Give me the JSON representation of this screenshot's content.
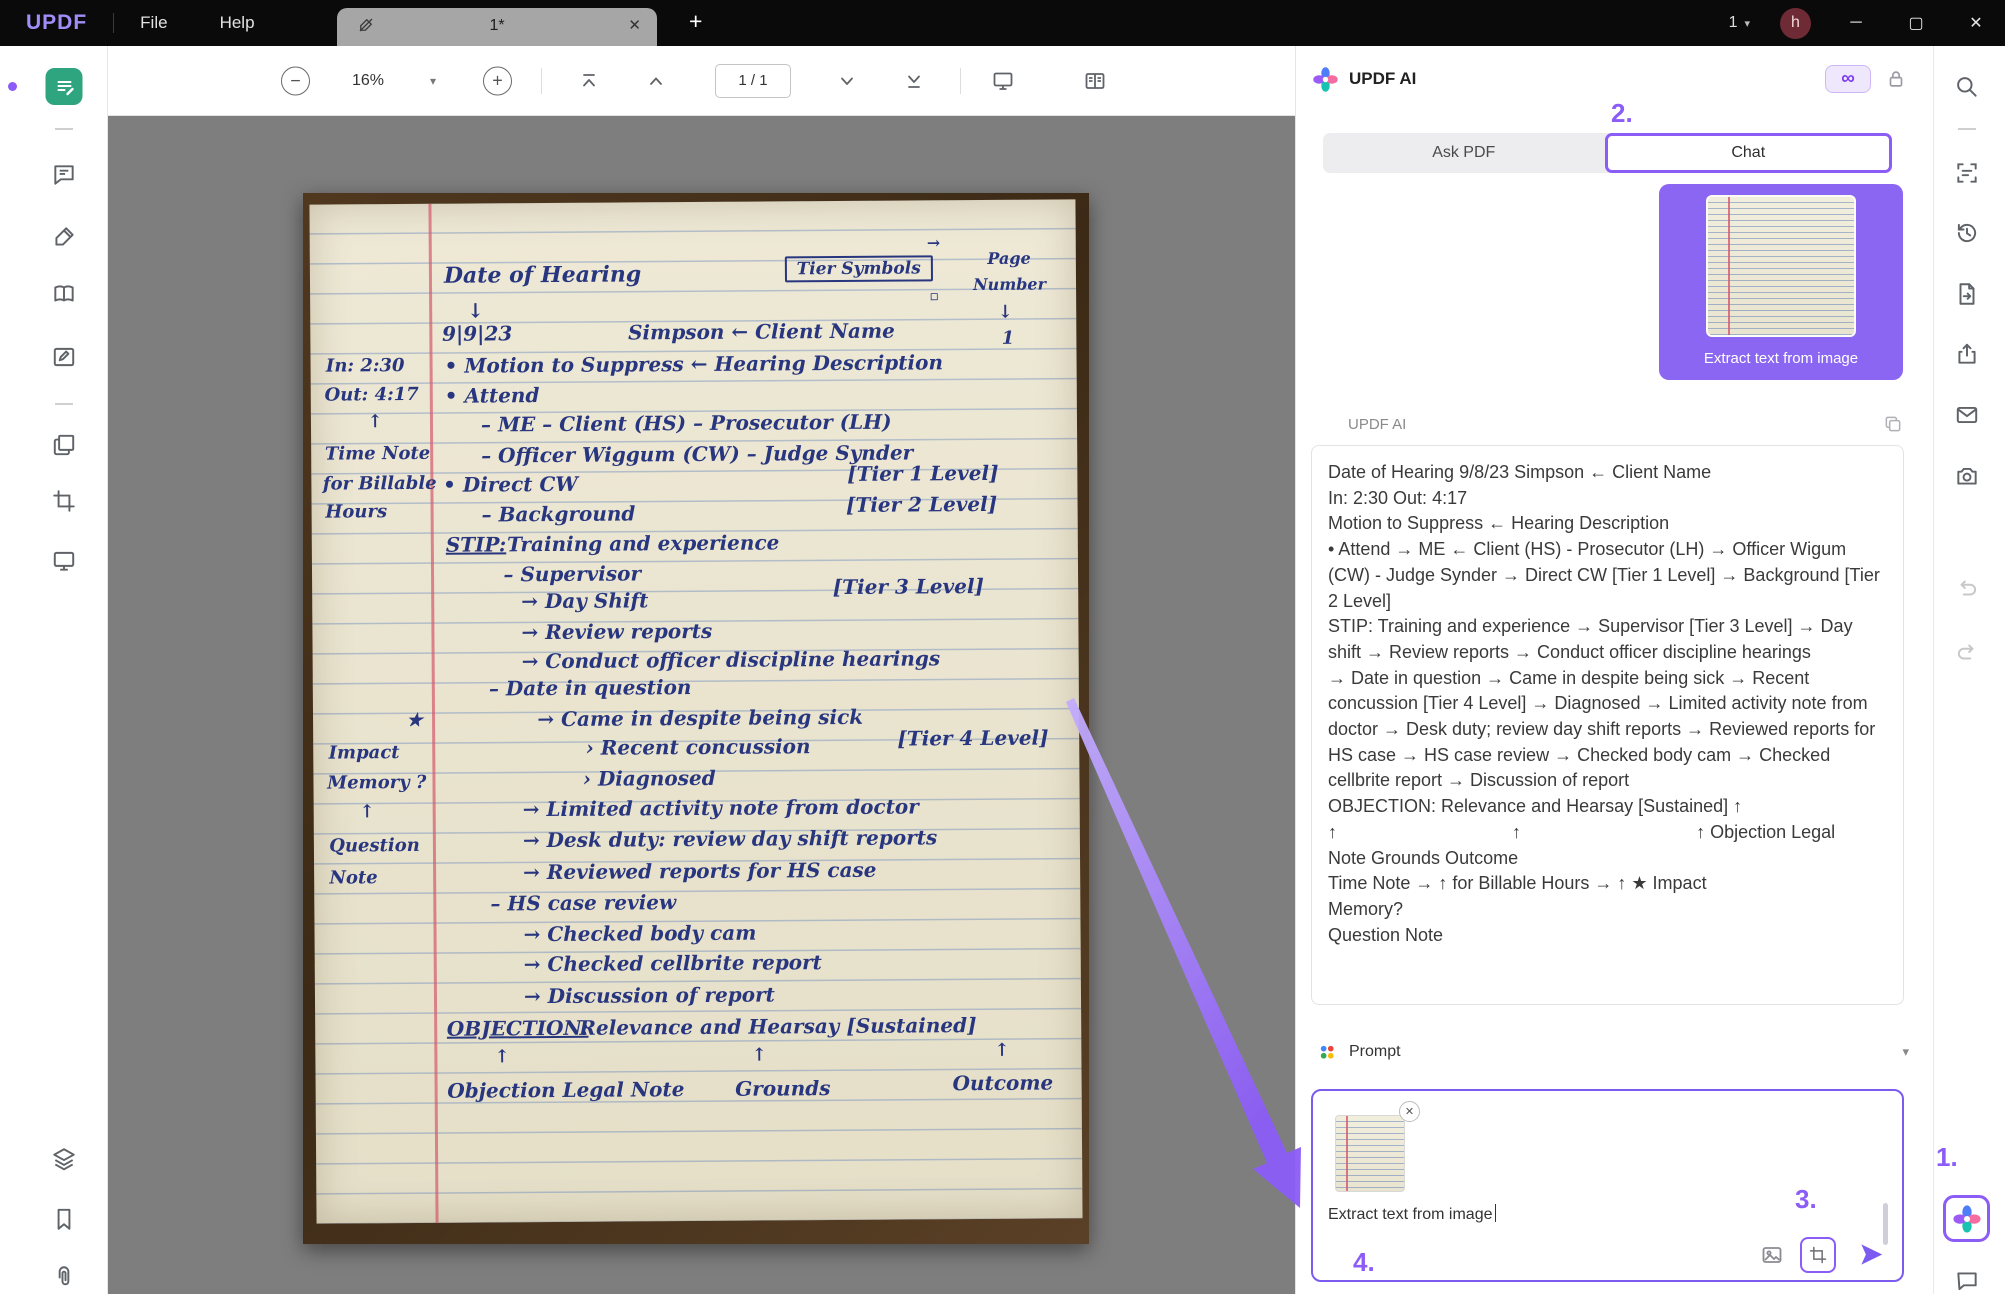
{
  "colors": {
    "accent": "#8B5CF6",
    "accent_light": "#B79CFC",
    "topbar": "#0A0A0A",
    "doc_bg": "#7E7E7E",
    "tab_gray": "#A6A6A6",
    "paper": "#EBE6D2",
    "ink": "#28367F",
    "margin_red": "#D4596B",
    "wood": "#46301F",
    "bubble": "#8A66F2",
    "avatar_bg": "#6E2B35",
    "icon_gray": "#5F6368",
    "reader_green": "#2EA57E"
  },
  "topbar": {
    "logo": "UPDF",
    "menu_file": "File",
    "menu_help": "Help",
    "tab_label": "1*",
    "tab_count": "1",
    "avatar_initial": "h"
  },
  "toolbar": {
    "zoom_value": "16%",
    "page_indicator": "1 / 1"
  },
  "icons": {
    "minimize": "─",
    "maximize": "▢",
    "close": "✕",
    "tab_close": "✕",
    "new_tab": "+",
    "dropdown_caret": "▾",
    "infinity": "∞",
    "remove_thumb": "✕",
    "left_rail": [
      "reader-mode-icon",
      "comment-icon",
      "edit-text-icon",
      "read-book-icon",
      "form-icon",
      "organize-pages-icon",
      "crop-page-icon",
      "slideshow-icon",
      "layers-icon",
      "bookmark-icon",
      "attachment-icon"
    ],
    "right_rail": [
      "search-icon",
      "ocr-icon",
      "history-icon",
      "save-as-icon",
      "export-icon",
      "email-icon",
      "capture-icon",
      "undo-icon",
      "redo-icon",
      "updf-ai-icon",
      "feedback-icon"
    ]
  },
  "annotations": {
    "step1": "1.",
    "step2": "2.",
    "step3": "3.",
    "step4": "4."
  },
  "ai_panel": {
    "title": "UPDF AI",
    "tab_ask": "Ask PDF",
    "tab_chat": "Chat",
    "user_message_caption": "Extract text from image",
    "response_label": "UPDF AI",
    "response_lines": [
      "Date of Hearing 9/8/23 Simpson ← Client Name",
      "In: 2:30 Out: 4:17",
      "Motion to Suppress ← Hearing Description",
      "• Attend → ME ← Client (HS) - Prosecutor (LH) → Officer Wigum (CW) - Judge Synder → Direct CW [Tier 1 Level] → Background [Tier 2 Level]",
      "STIP: Training and experience → Supervisor [Tier 3 Level] → Day shift → Review reports → Conduct officer discipline hearings",
      "→ Date in question → Came in despite being sick → Recent concussion [Tier 4 Level] → Diagnosed → Limited activity note from doctor → Desk duty; review day shift reports → Reviewed reports for HS case → HS case review → Checked body cam → Checked cellbrite report → Discussion of report",
      "OBJECTION: Relevance and Hearsay [Sustained] ↑",
      "↑                                   ↑                                   ↑ Objection Legal",
      "Note Grounds Outcome",
      "Time Note → ↑ for Billable Hours → ↑ ★ Impact",
      "Memory?",
      "Question Note"
    ],
    "prompt_header": "Prompt",
    "prompt_text": "Extract text from image"
  },
  "document": {
    "note_lines": [
      {
        "text": "Date of Hearing",
        "x": 17.5,
        "y": 5.8,
        "size": 22
      },
      {
        "text": "↓",
        "x": 20.5,
        "y": 9.3
      },
      {
        "text": "Tier Symbols",
        "x": 62,
        "y": 5.4,
        "size": 17,
        "cls": "boxed"
      },
      {
        "text": "→",
        "x": 80.6,
        "y": 3.2,
        "size": 16
      },
      {
        "text": "▫",
        "x": 80.9,
        "y": 8.6,
        "size": 14
      },
      {
        "text": "Page",
        "x": 88.5,
        "y": 4.8,
        "size": 16
      },
      {
        "text": "Number",
        "x": 86.6,
        "y": 7.4,
        "size": 16
      },
      {
        "text": "↓",
        "x": 89.8,
        "y": 10.0,
        "size": 18
      },
      {
        "text": "1",
        "x": 90.3,
        "y": 12.6,
        "size": 18
      },
      {
        "text": "9|9|23",
        "x": 17.2,
        "y": 11.6
      },
      {
        "text": "Simpson ← Client Name",
        "x": 41.5,
        "y": 11.6
      },
      {
        "text": "In: 2:30",
        "x": 2.0,
        "y": 14.8,
        "size": 18
      },
      {
        "text": "• Motion to Suppress ← Hearing Description",
        "x": 17.5,
        "y": 14.7
      },
      {
        "text": "Out: 4:17",
        "x": 1.8,
        "y": 17.7,
        "size": 18
      },
      {
        "text": "• Attend",
        "x": 17.5,
        "y": 17.7
      },
      {
        "text": "↑",
        "x": 7.4,
        "y": 20.3,
        "size": 18
      },
      {
        "text": "– ME    – Client (HS)    – Prosecutor (LH)",
        "x": 22.2,
        "y": 20.5
      },
      {
        "text": "Time Note",
        "x": 1.8,
        "y": 23.4,
        "size": 18
      },
      {
        "text": "– Officer Wiggum (CW) – Judge Synder",
        "x": 22.2,
        "y": 23.5
      },
      {
        "text": "for Billable",
        "x": 1.5,
        "y": 26.4,
        "size": 18
      },
      {
        "text": "• Direct CW",
        "x": 17.2,
        "y": 26.4
      },
      {
        "text": "[Tier 1 Level]",
        "x": 70.0,
        "y": 25.6
      },
      {
        "text": "Hours",
        "x": 1.8,
        "y": 29.1,
        "size": 18
      },
      {
        "text": "– Background",
        "x": 22.2,
        "y": 29.3
      },
      {
        "text": "[Tier 2 Level]",
        "x": 69.8,
        "y": 28.6
      },
      {
        "text": "STIP:",
        "x": 17.5,
        "y": 32.3,
        "cls": "underline"
      },
      {
        "text": "Training and experience",
        "x": 25.5,
        "y": 32.3
      },
      {
        "text": "– Supervisor",
        "x": 25.0,
        "y": 35.2
      },
      {
        "text": "→ Day Shift",
        "x": 27.3,
        "y": 37.9
      },
      {
        "text": "[Tier 3 Level]",
        "x": 68.0,
        "y": 36.7
      },
      {
        "text": "→ Review reports",
        "x": 27.3,
        "y": 40.9
      },
      {
        "text": "→ Conduct officer discipline hearings",
        "x": 27.3,
        "y": 43.7
      },
      {
        "text": "– Date in question",
        "x": 23.0,
        "y": 46.4
      },
      {
        "text": "★",
        "x": 12.2,
        "y": 49.6,
        "size": 18
      },
      {
        "text": "→ Came in despite being sick",
        "x": 29.3,
        "y": 49.4
      },
      {
        "text": "Impact",
        "x": 2.0,
        "y": 52.8,
        "size": 18
      },
      {
        "text": "› Recent concussion",
        "x": 35.6,
        "y": 52.3
      },
      {
        "text": "[Tier 4 Level]",
        "x": 76.3,
        "y": 51.6
      },
      {
        "text": "Memory ?",
        "x": 1.8,
        "y": 55.7,
        "size": 18
      },
      {
        "text": "› Diagnosed",
        "x": 35.2,
        "y": 55.3
      },
      {
        "text": "↑",
        "x": 6.0,
        "y": 58.6,
        "size": 18
      },
      {
        "text": "→ Limited activity note from doctor",
        "x": 27.3,
        "y": 58.3
      },
      {
        "text": "Question",
        "x": 2.0,
        "y": 61.9,
        "size": 18
      },
      {
        "text": "→ Desk duty: review day shift reports",
        "x": 27.3,
        "y": 61.3
      },
      {
        "text": "Note",
        "x": 2.0,
        "y": 65.0,
        "size": 18
      },
      {
        "text": "→ Reviewed reports for HS case",
        "x": 27.3,
        "y": 64.4
      },
      {
        "text": "– HS case review",
        "x": 23.0,
        "y": 67.5
      },
      {
        "text": "→ Checked body cam",
        "x": 27.3,
        "y": 70.5
      },
      {
        "text": "→ Checked cellbrite report",
        "x": 27.3,
        "y": 73.5
      },
      {
        "text": "→ Discussion of report",
        "x": 27.3,
        "y": 76.6
      },
      {
        "text": "OBJECTION:",
        "x": 17.2,
        "y": 79.7,
        "cls": "underline"
      },
      {
        "text": "Relevance and Hearsay [Sustained]",
        "x": 34.5,
        "y": 79.7
      },
      {
        "text": "↑",
        "x": 23.4,
        "y": 82.7,
        "size": 18
      },
      {
        "text": "↑",
        "x": 57.0,
        "y": 82.7,
        "size": 18
      },
      {
        "text": "↑",
        "x": 88.7,
        "y": 82.4,
        "size": 18
      },
      {
        "text": "Objection Legal Note",
        "x": 17.2,
        "y": 85.8
      },
      {
        "text": "Grounds",
        "x": 54.8,
        "y": 85.8
      },
      {
        "text": "Outcome",
        "x": 83.2,
        "y": 85.4
      }
    ]
  }
}
